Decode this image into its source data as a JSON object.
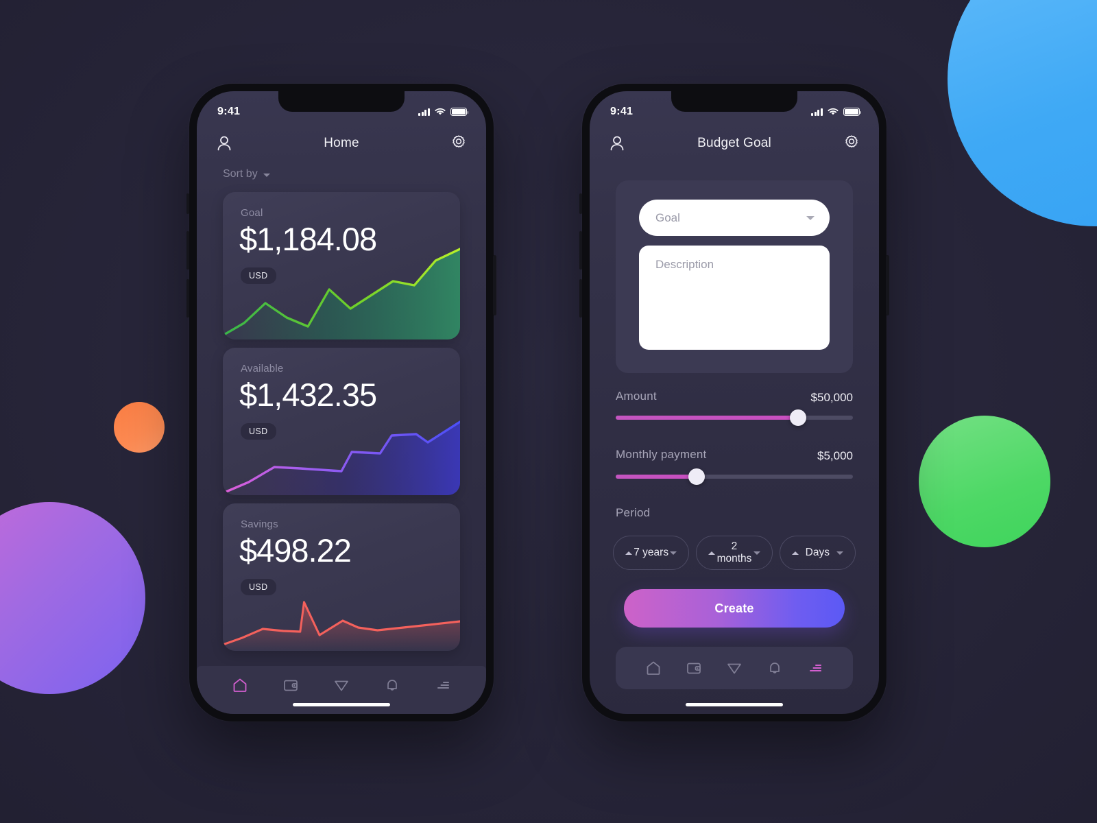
{
  "colors": {
    "background": "#272539",
    "phone_body": "#0d0d11",
    "screen_top": "#393750",
    "card_surface": "#3a3850",
    "accent_magenta": "#d35fd0",
    "accent_blue": "#5b59f5",
    "chart_green": "#7ed321",
    "chart_purple": "#a65cf0",
    "chart_blue": "#4f53f0",
    "chart_red": "#f15b58",
    "blob_blue": "#3fa9f5",
    "blob_green": "#4dd865",
    "blob_purple": "#a06ae2",
    "blob_orange": "#fd8a52"
  },
  "home_screen": {
    "status": {
      "time": "9:41",
      "signal_icon": "cellular-bars-icon",
      "wifi_icon": "wifi-icon",
      "battery_icon": "battery-icon"
    },
    "appbar": {
      "title": "Home",
      "left_icon": "profile-icon",
      "right_icon": "gear-icon"
    },
    "sort": {
      "label": "Sort by",
      "caret_icon": "chevron-down-icon"
    },
    "cards": [
      {
        "label": "Goal",
        "amount": "$1,184.08",
        "currency": "USD",
        "chart": "goal-chart"
      },
      {
        "label": "Available",
        "amount": "$1,432.35",
        "currency": "USD",
        "chart": "available-chart"
      },
      {
        "label": "Savings",
        "amount": "$498.22",
        "currency": "USD",
        "chart": "savings-chart"
      }
    ],
    "nav": [
      {
        "icon": "home-icon",
        "active": true
      },
      {
        "icon": "wallet-icon",
        "active": false
      },
      {
        "icon": "paper-plane-icon",
        "active": false
      },
      {
        "icon": "bell-icon",
        "active": false
      },
      {
        "icon": "menu-lines-icon",
        "active": false
      }
    ]
  },
  "budget_screen": {
    "status": {
      "time": "9:41",
      "signal_icon": "cellular-bars-icon",
      "wifi_icon": "wifi-icon",
      "battery_icon": "battery-icon"
    },
    "appbar": {
      "title": "Budget Goal",
      "left_icon": "profile-icon",
      "right_icon": "gear-icon"
    },
    "form": {
      "goal_placeholder": "Goal",
      "goal_caret_icon": "chevron-down-icon",
      "description_placeholder": "Description"
    },
    "amount": {
      "label": "Amount",
      "value": "$50,000",
      "fill_percent": 77
    },
    "monthly": {
      "label": "Monthly payment",
      "value": "$5,000",
      "fill_percent": 34
    },
    "period": {
      "label": "Period",
      "options": [
        {
          "value": "7 years",
          "up_icon": "caret-up-icon",
          "down_icon": "caret-down-icon"
        },
        {
          "value": "2 months",
          "up_icon": "caret-up-icon",
          "down_icon": "caret-down-icon"
        },
        {
          "value": "Days",
          "up_icon": "caret-up-icon",
          "down_icon": "caret-down-icon"
        }
      ]
    },
    "create_label": "Create",
    "nav": [
      {
        "icon": "home-icon",
        "active": false
      },
      {
        "icon": "wallet-icon",
        "active": false
      },
      {
        "icon": "paper-plane-icon",
        "active": false
      },
      {
        "icon": "bell-icon",
        "active": false
      },
      {
        "icon": "menu-lines-icon",
        "active": true
      }
    ]
  },
  "chart_data": [
    {
      "type": "line",
      "title": "Goal",
      "series": [
        {
          "name": "Goal",
          "values": [
            4,
            20,
            34,
            24,
            14,
            52,
            30,
            46,
            60,
            56,
            84,
            96
          ]
        }
      ],
      "x": [
        0,
        1,
        2,
        3,
        4,
        5,
        6,
        7,
        8,
        9,
        10,
        11
      ],
      "ylim": [
        0,
        100
      ],
      "grid": false,
      "legend": "none",
      "color": "#7ed321"
    },
    {
      "type": "line",
      "title": "Available",
      "series": [
        {
          "name": "Available",
          "values": [
            2,
            12,
            22,
            26,
            22,
            20,
            36,
            38,
            34,
            58,
            54,
            72
          ]
        }
      ],
      "x": [
        0,
        1,
        2,
        3,
        4,
        5,
        6,
        7,
        8,
        9,
        10,
        11
      ],
      "ylim": [
        0,
        100
      ],
      "grid": false,
      "legend": "none",
      "color": "#5c57ee"
    },
    {
      "type": "line",
      "title": "Savings",
      "series": [
        {
          "name": "Savings",
          "values": [
            6,
            22,
            32,
            30,
            26,
            78,
            18,
            40,
            52,
            30,
            32,
            40
          ]
        }
      ],
      "x": [
        0,
        1,
        2,
        3,
        4,
        5,
        6,
        7,
        8,
        9,
        10,
        11
      ],
      "ylim": [
        0,
        100
      ],
      "grid": false,
      "legend": "none",
      "color": "#f15b58"
    }
  ]
}
